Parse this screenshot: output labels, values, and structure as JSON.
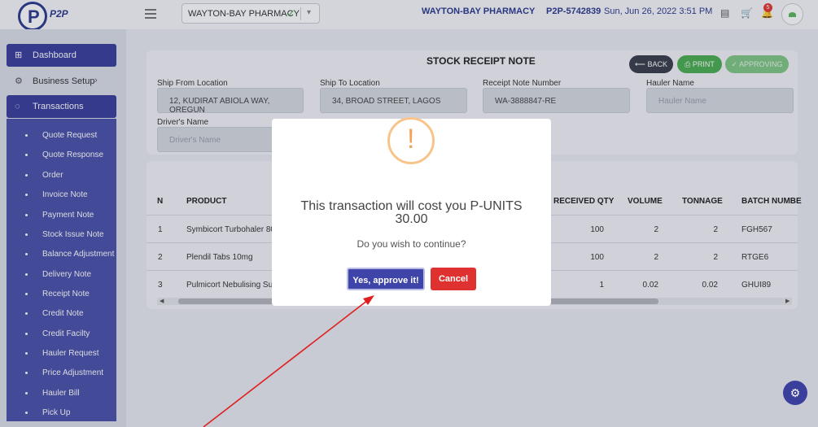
{
  "topbar": {
    "logo_text": "P2P",
    "pharmacy_select": "WAYTON-BAY PHARMACY",
    "pharmacy_name": "WAYTON-BAY PHARMACY",
    "user_code": "P2P-5742839",
    "datetime": "Sun, Jun 26, 2022 3:51 PM",
    "notification_count": "5"
  },
  "sidebar": {
    "items": [
      {
        "label": "Dashboard",
        "icon": "grid-icon"
      },
      {
        "label": "Business Setup",
        "icon": "gear-icon"
      },
      {
        "label": "Transactions",
        "icon": "circle-icon"
      }
    ],
    "sub_items": [
      "Quote Request",
      "Quote Response",
      "Order",
      "Invoice Note",
      "Payment Note",
      "Stock Issue Note",
      "Balance Adjustment",
      "Delivery Note",
      "Receipt Note",
      "Credit Note",
      "Credit Facilty",
      "Hauler Request",
      "Price Adjustment",
      "Hauler Bill",
      "Pick Up"
    ]
  },
  "note": {
    "title": "STOCK RECEIPT NOTE",
    "back_label": "BACK",
    "print_label": "PRINT",
    "approving_label": "APPROVING",
    "ship_from_label": "Ship From Location",
    "ship_from_value": "12, KUDIRAT ABIOLA WAY, OREGUN",
    "ship_to_label": "Ship To Location",
    "ship_to_value": "34, BROAD STREET, LAGOS",
    "receipt_no_label": "Receipt Note Number",
    "receipt_no_value": "WA-3888847-RE",
    "hauler_label": "Hauler Name",
    "hauler_placeholder": "Hauler Name",
    "driver_label": "Driver's Name",
    "driver_placeholder": "Driver's Name"
  },
  "table": {
    "headers": {
      "sn": "N",
      "product": "PRODUCT",
      "received": "RECEIVED QTY",
      "volume": "VOLUME",
      "tonnage": "TONNAGE",
      "batch": "BATCH NUMBE"
    },
    "rows": [
      {
        "sn": "1",
        "product": "Symbicort Turbohaler 80/",
        "received": "100",
        "volume": "2",
        "tonnage": "2",
        "batch": "FGH567"
      },
      {
        "sn": "2",
        "product": "Plendil Tabs 10mg",
        "received": "100",
        "volume": "2",
        "tonnage": "2",
        "batch": "RTGE6"
      },
      {
        "sn": "3",
        "product": "Pulmicort Nebulising Susp",
        "received": "1",
        "volume": "0.02",
        "tonnage": "0.02",
        "batch": "GHUI89"
      }
    ]
  },
  "modal": {
    "icon": "!",
    "title": "This transaction will cost you P-UNITS 30.00",
    "text": "Do you wish to continue?",
    "confirm_label": "Yes, approve it!",
    "cancel_label": "Cancel"
  },
  "colors": {
    "primary": "#3a3f9c",
    "danger": "#e03131",
    "success": "#4caf50",
    "warning": "#f8c48c"
  }
}
